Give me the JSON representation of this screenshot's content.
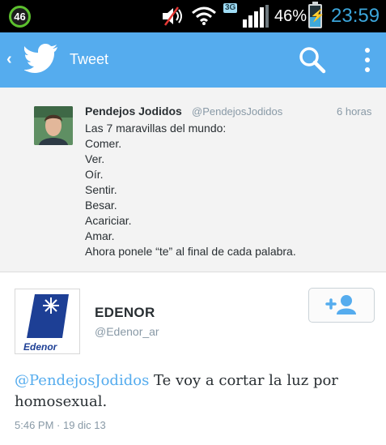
{
  "status_bar": {
    "notification_count": "46",
    "network_type": "3G",
    "battery_percent": "46%",
    "battery_level": 0.46,
    "time": "23:59",
    "icons": [
      "mute-icon",
      "wifi-icon",
      "signal-icon",
      "battery-icon"
    ]
  },
  "action_bar": {
    "title": "Tweet",
    "color": "#55acee",
    "icons": [
      "back-chevron-icon",
      "twitter-bird-icon",
      "search-icon",
      "overflow-menu-icon"
    ]
  },
  "quoted_tweet": {
    "name": "Pendejos Jodidos",
    "handle": "@PendejosJodidos",
    "time": "6 horas",
    "lines": [
      "Las 7 maravillas del mundo:",
      "Comer.",
      "Ver.",
      "Oír.",
      "Sentir.",
      "Besar.",
      "Acariciar.",
      "Amar.",
      "Ahora ponele “te” al final de cada palabra."
    ]
  },
  "main_tweet": {
    "name": "EDENOR",
    "handle": "@Edenor_ar",
    "logo_text": "Edenor",
    "mention": "@PendejosJodidos",
    "text": " Te voy a cortar la luz por homosexual.",
    "timestamp": "5:46 PM · 19 dic 13",
    "follow_icon": "add-user-icon"
  }
}
